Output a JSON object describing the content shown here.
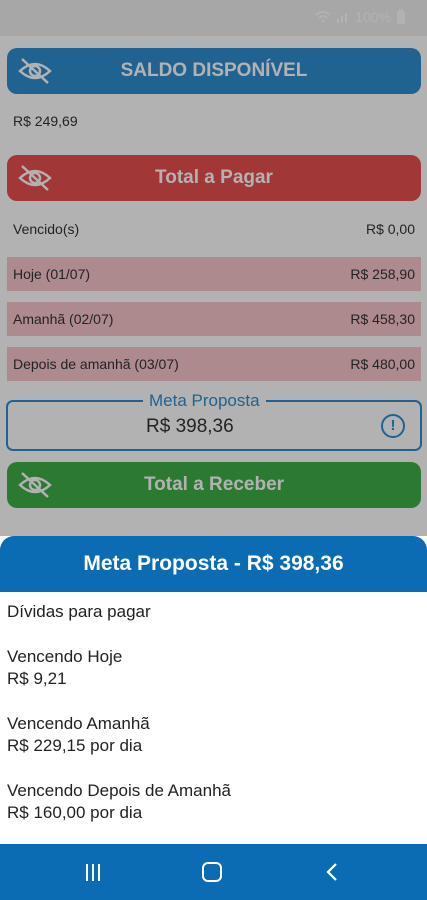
{
  "status": {
    "battery": "100%"
  },
  "saldo": {
    "title": "SALDO DISPONÍVEL",
    "value": "R$ 249,69"
  },
  "total_pagar": {
    "title": "Total a Pagar",
    "rows": [
      {
        "label": "Vencido(s)",
        "value": "R$ 0,00"
      },
      {
        "label": "Hoje (01/07)",
        "value": "R$ 258,90"
      },
      {
        "label": "Amanhã (02/07)",
        "value": "R$ 458,30"
      },
      {
        "label": "Depois de amanhã (03/07)",
        "value": "R$ 480,00"
      }
    ]
  },
  "meta": {
    "label": "Meta Proposta",
    "value": "R$ 398,36",
    "info": "!"
  },
  "total_receber": {
    "title": "Total a Receber"
  },
  "sheet": {
    "title": "Meta Proposta - R$ 398,36",
    "intro": "Dívidas para pagar",
    "items": [
      {
        "label": "Vencendo Hoje",
        "value": "R$ 9,21"
      },
      {
        "label": "Vencendo Amanhã",
        "value": "R$ 229,15 por dia"
      },
      {
        "label": "Vencendo Depois de Amanhã",
        "value": "R$ 160,00 por dia"
      }
    ]
  },
  "colors": {
    "blue": "#2f8fd0",
    "red": "#e84f4f",
    "green": "#3fae47",
    "sheet_header": "#0b6cb3"
  },
  "icons": {
    "visibility": "eye-slash-icon",
    "info": "info-icon"
  }
}
